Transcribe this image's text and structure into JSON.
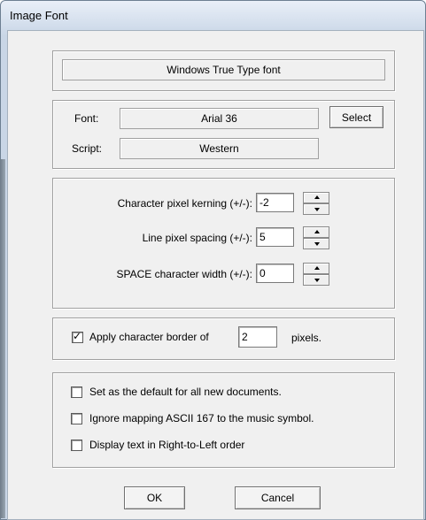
{
  "window": {
    "title": "Image Font"
  },
  "font_type": {
    "label": "Windows True Type font"
  },
  "font_section": {
    "font_label": "Font:",
    "font_value": "Arial  36",
    "select_button": "Select",
    "script_label": "Script:",
    "script_value": "Western"
  },
  "spacing": {
    "kerning_label": "Character pixel kerning (+/-):",
    "kerning_value": "-2",
    "line_label": "Line pixel spacing (+/-):",
    "line_value": "5",
    "space_label": "SPACE character width (+/-):",
    "space_value": "0"
  },
  "border": {
    "checked": true,
    "label": "Apply character border of",
    "value": "2",
    "unit": "pixels."
  },
  "options": [
    {
      "label": "Set as the default for all new documents.",
      "checked": false
    },
    {
      "label": "Ignore mapping ASCII 167 to the music symbol.",
      "checked": false
    },
    {
      "label": "Display text in Right-to-Left order",
      "checked": false
    }
  ],
  "buttons": {
    "ok": "OK",
    "cancel": "Cancel"
  }
}
